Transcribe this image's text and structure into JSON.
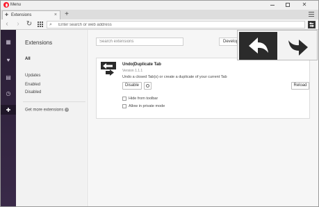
{
  "window": {
    "menu_label": "Menu"
  },
  "tabs": [
    {
      "title": "Extensions",
      "icon": "puzzle-icon"
    }
  ],
  "toolbar": {
    "address_placeholder": "Enter search or web address"
  },
  "sidebar": {
    "items": [
      {
        "icon": "speed-dial-icon",
        "active": false
      },
      {
        "icon": "heart-icon",
        "active": false
      },
      {
        "icon": "news-icon",
        "active": false
      },
      {
        "icon": "history-icon",
        "active": false
      },
      {
        "icon": "extensions-icon",
        "active": true
      }
    ]
  },
  "extensions_nav": {
    "title": "Extensions",
    "items": [
      "All",
      "Updates",
      "Enabled",
      "Disabled"
    ],
    "get_more": "Get more extensions"
  },
  "content": {
    "search_placeholder": "Search extensions",
    "developer_button": "Developer Mode"
  },
  "extension": {
    "name": "Undo|Duplicate Tab",
    "version": "Version 1.1.1",
    "description": "Undo a closed Tab(s) or create a duplicate of your current Tab",
    "disable_label": "Disable",
    "reload_label": "Reload",
    "options": [
      {
        "label": "Hide from toolbar",
        "checked": false
      },
      {
        "label": "Allow in private mode",
        "checked": false
      }
    ]
  },
  "colors": {
    "opera_red": "#ff1b2d",
    "sidebar_bg": "#2a1e35",
    "popup_dark": "#2b2b2b"
  }
}
